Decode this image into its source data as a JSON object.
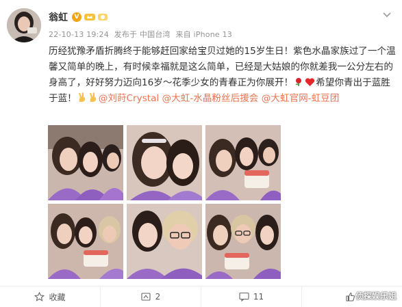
{
  "post": {
    "user_name": "翁虹",
    "verified_badge": "V",
    "timestamp": "22-10-13 19:24",
    "posted_from_label": "发布于 中国台湾",
    "device_label": "来自 iPhone 13",
    "text_main": "历经犹豫矛盾折腾终于能够赶回家给宝贝过她的15岁生日！紫色水晶家族过了一个温馨又简单的晚上，有时候幸福就是这么简单，已经是大姑娘的你就差我一公分左右的身高了，好好努力迈向16岁～花季少女的青春正为你展开！",
    "text_tail": "希望你青出于蓝胜于蓝！",
    "mention_1": "@刘莳Crystal",
    "mention_2": "@大虹-水晶粉丝后援会",
    "mention_3": "@大虹官网-虹豆团",
    "emojis": [
      "rose",
      "heart",
      "victory-hand",
      "victory-hand"
    ]
  },
  "photos_count": 6,
  "footer": {
    "favorite_label": "收藏",
    "repost_count": "2",
    "comment_count": "11"
  },
  "watermark": "侦探娱乐姐",
  "colors": {
    "link": "#eb7350",
    "badge": "#f0a517",
    "meta": "#939393",
    "fans_icon": "#f7c23a",
    "purple_top": "#9a6bc6"
  }
}
